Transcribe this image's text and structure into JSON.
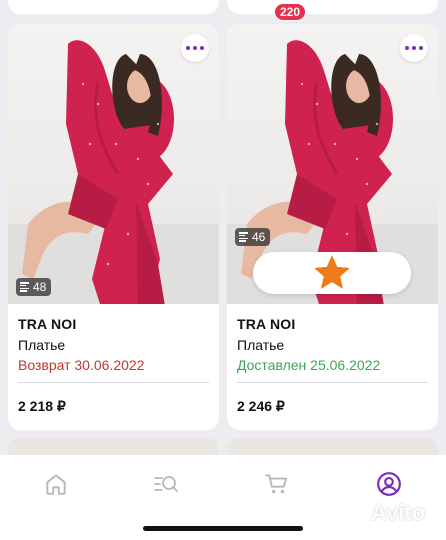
{
  "products": [
    {
      "brand": "TRA NOI",
      "type": "Платье",
      "status": "Возврат 30.06.2022",
      "status_color": "#c0392b",
      "price": "2 218 ₽",
      "photo_count": "48",
      "more_icon": "more-dots-icon",
      "rating_stars": null
    },
    {
      "brand": "TRA NOI",
      "type": "Платье",
      "status": "Доставлен 25.06.2022",
      "status_color": "#3aa655",
      "price": "2 246 ₽",
      "photo_count": "46",
      "more_icon": "more-dots-icon",
      "rating_stars": 5
    }
  ],
  "tabbar": {
    "items": [
      "home-icon",
      "catalog-search-icon",
      "cart-icon",
      "profile-icon"
    ],
    "active": "profile-icon",
    "cart_badge": "220",
    "accent_color": "#7b2cbf"
  },
  "watermark": "Avito",
  "colors": {
    "dress": "#d0224e",
    "star": "#f07a1a",
    "badge": "#e5304f"
  }
}
